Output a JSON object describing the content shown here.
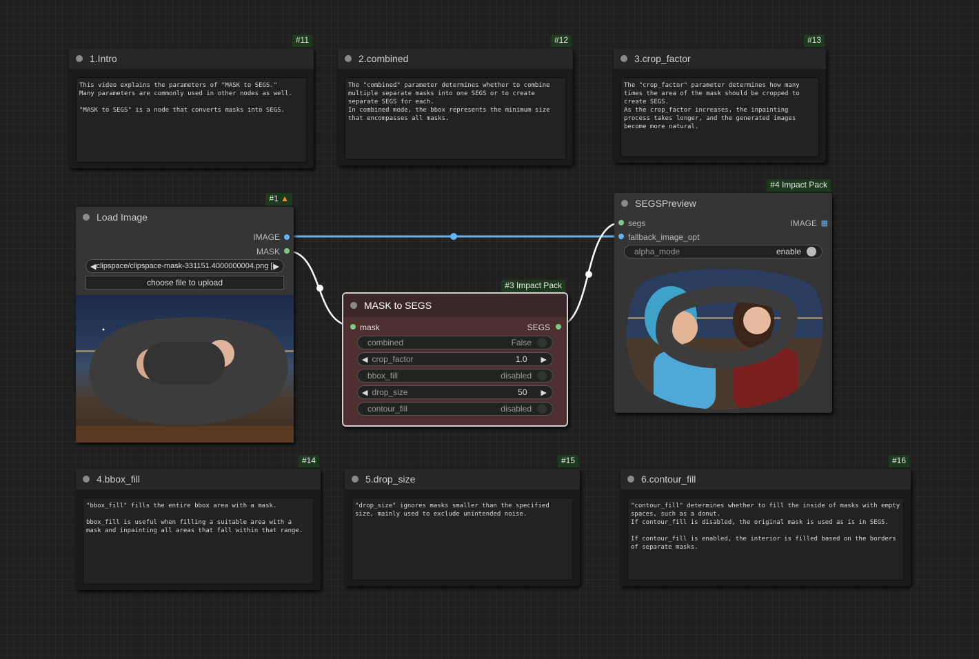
{
  "notes": [
    {
      "id": "#11",
      "title": "1.Intro",
      "text": "This video explains the parameters of \"MASK to SEGS.\"\nMany parameters are commonly used in other nodes as well.\n\n\"MASK to SEGS\" is a node that converts masks into SEGS."
    },
    {
      "id": "#12",
      "title": "2.combined",
      "text": "The \"combined\" parameter determines whether to combine multiple separate masks into one SEGS or to create separate SEGS for each.\nIn combined mode, the bbox represents the minimum size that encompasses all masks."
    },
    {
      "id": "#13",
      "title": "3.crop_factor",
      "text": "The \"crop_factor\" parameter determines how many times the area of the mask should be cropped to create SEGS.\nAs the crop_factor increases, the inpainting process takes longer, and the generated images become more natural."
    },
    {
      "id": "#14",
      "title": "4.bbox_fill",
      "text": "\"bbox_fill\" fills the entire bbox area with a mask.\n\nbbox_fill is useful when filling a suitable area with a mask and inpainting all areas that fall within that range."
    },
    {
      "id": "#15",
      "title": "5.drop_size",
      "text": "\"drop_size\" ignores masks smaller than the specified size, mainly used to exclude unintended noise."
    },
    {
      "id": "#16",
      "title": "6.contour_fill",
      "text": "\"contour_fill\" determines whether to fill the inside of masks with empty spaces, such as a donut.\nIf contour_fill is disabled, the original mask is used as is in SEGS.\n\nIf contour_fill is enabled, the interior is filled based on the borders of separate masks."
    }
  ],
  "load_image": {
    "id": "#1",
    "badge_icon": "fox-icon",
    "title": "Load Image",
    "out_image": "IMAGE",
    "out_mask": "MASK",
    "file_value": "clipspace/clipspace-mask-331151.4000000004.png [input]",
    "upload_label": "choose file to upload"
  },
  "mask_to_segs": {
    "id": "#3 Impact Pack",
    "title": "MASK to SEGS",
    "in_mask": "mask",
    "out_segs": "SEGS",
    "widgets": [
      {
        "label": "combined",
        "value": "False"
      },
      {
        "label": "crop_factor",
        "value": "1.0"
      },
      {
        "label": "bbox_fill",
        "value": "disabled"
      },
      {
        "label": "drop_size",
        "value": "50"
      },
      {
        "label": "contour_fill",
        "value": "disabled"
      }
    ]
  },
  "segs_preview": {
    "id": "#4 Impact Pack",
    "title": "SEGSPreview",
    "in_segs": "segs",
    "in_fallback": "fallback_image_opt",
    "out_image": "IMAGE",
    "alpha_label": "alpha_mode",
    "alpha_value": "enable"
  },
  "colors": {
    "image_link": "#64b5f6",
    "mask_link": "#81c784",
    "segs_link": "#ffffff",
    "mask_node_bg": "#4d2f2f",
    "badge_bg": "#1e3a1e"
  }
}
